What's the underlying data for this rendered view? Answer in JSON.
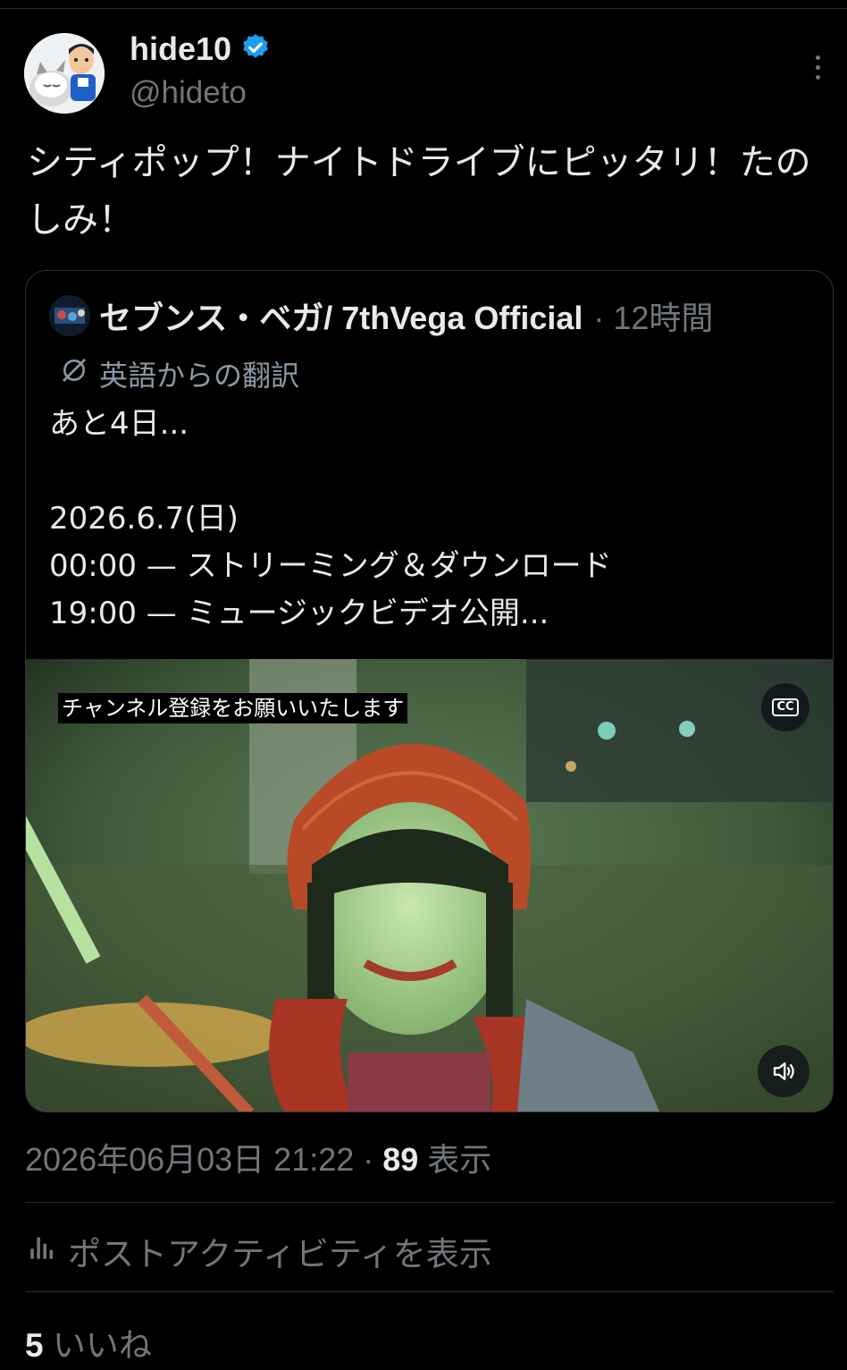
{
  "author": {
    "display_name": "hide10",
    "handle": "@hideto",
    "verified": true,
    "verified_color": "#1d9bf0"
  },
  "tweet": {
    "text": "シティポップ！ナイトドライブにピッタリ！たのしみ！"
  },
  "quote": {
    "author_name": "セブンス・ベガ/ 7thVega Official",
    "time": "· 12時間",
    "translation_label": "英語からの翻訳",
    "body": "あと4日...\n\n2026.6.7(日)\n00:00 — ストリーミング＆ダウンロード\n19:00 — ミュージックビデオ公開...",
    "video": {
      "caption": "チャンネル登録をお願いいたします",
      "cc_label": "CC"
    }
  },
  "meta": {
    "timestamp": "2026年06月03日 21:22 · ",
    "views_count": "89",
    "views_label": " 表示"
  },
  "activity": {
    "label": "ポストアクティビティを表示"
  },
  "likes": {
    "count": "5",
    "label": " いいね"
  },
  "icons": [
    "more-icon",
    "verified-badge-icon",
    "translate-icon",
    "cc-icon",
    "volume-icon",
    "analytics-icon"
  ]
}
